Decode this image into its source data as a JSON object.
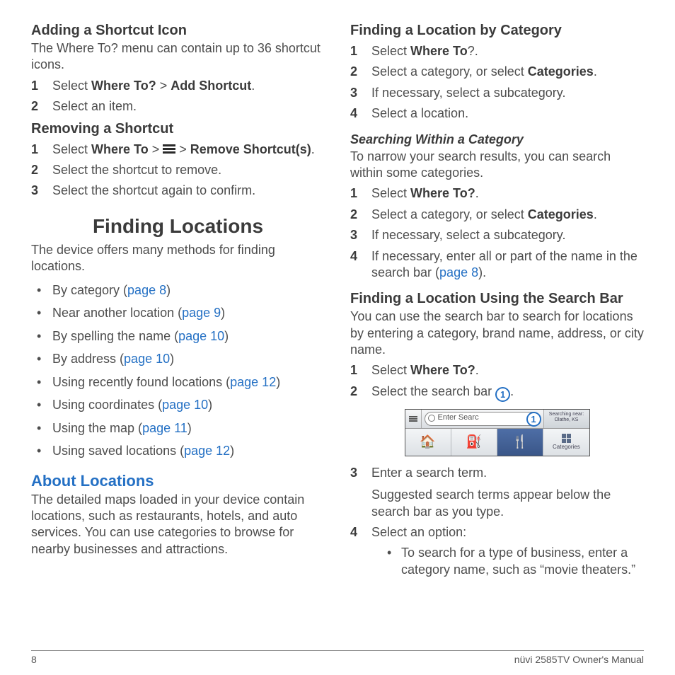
{
  "footer": {
    "pageNum": "8",
    "manual": "nüvi 2585TV Owner's Manual"
  },
  "left": {
    "adding": {
      "heading": "Adding a Shortcut Icon",
      "intro": "The Where To? menu can contain up to 36 shortcut icons.",
      "step1_pre": "Select ",
      "step1_b1": "Where To?",
      "step1_mid": " > ",
      "step1_b2": "Add Shortcut",
      "step1_post": ".",
      "step2": "Select an item."
    },
    "removing": {
      "heading": "Removing a Shortcut",
      "step1_pre": "Select ",
      "step1_b1": "Where To",
      "step1_mid1": " > ",
      "step1_mid2": " > ",
      "step1_b2": "Remove Shortcut(s)",
      "step1_post": ".",
      "step2": "Select the shortcut to remove.",
      "step3": "Select the shortcut again to confirm."
    },
    "finding": {
      "heading": "Finding Locations",
      "intro": "The device offers many methods for finding locations.",
      "b1_t": "By category (",
      "b1_l": "page 8",
      "b1_e": ")",
      "b2_t": "Near another location (",
      "b2_l": "page 9",
      "b2_e": ")",
      "b3_t": "By spelling the name (",
      "b3_l": "page 10",
      "b3_e": ")",
      "b4_t": "By address (",
      "b4_l": "page 10",
      "b4_e": ")",
      "b5_t": "Using recently found locations (",
      "b5_l": "page 12",
      "b5_e": ")",
      "b6_t": "Using coordinates (",
      "b6_l": "page 10",
      "b6_e": ")",
      "b7_t": "Using the map (",
      "b7_l": "page 11",
      "b7_e": ")",
      "b8_t": "Using saved locations (",
      "b8_l": "page 12",
      "b8_e": ")"
    },
    "about": {
      "heading": "About Locations",
      "intro": "The detailed maps loaded in your device contain locations, such as restaurants, hotels, and auto services. You can use categories to browse for nearby businesses and attractions."
    }
  },
  "right": {
    "byCat": {
      "heading": "Finding a Location by Category",
      "s1_pre": "Select ",
      "s1_b": "Where To",
      "s1_post": "?.",
      "s2_pre": "Select a category, or select ",
      "s2_b": "Categories",
      "s2_post": ".",
      "s3": "If necessary, select a subcategory.",
      "s4": "Select a location."
    },
    "within": {
      "heading": "Searching Within a Category",
      "intro": "To narrow your search results, you can search within some categories.",
      "s1_pre": "Select ",
      "s1_b": "Where To?",
      "s1_post": ".",
      "s2_pre": "Select a category, or select ",
      "s2_b": "Categories",
      "s2_post": ".",
      "s3": "If necessary, select a subcategory.",
      "s4_pre": "If necessary, enter all or part of the name in the search bar (",
      "s4_l": "page 8",
      "s4_post": ")."
    },
    "searchBar": {
      "heading": "Finding a Location Using the Search Bar",
      "intro": "You can use the search bar to search for locations by entering a category, brand name, address, or city name.",
      "s1_pre": "Select ",
      "s1_b": "Where To?",
      "s1_post": ".",
      "s2_pre": "Select the search bar ",
      "s2_c": "➀",
      "s2_post": ".",
      "figure": {
        "placeholder": "Enter Searc",
        "callout": "1",
        "near1": "Searching near:",
        "near2": "Olathe, KS",
        "catLabel": "Categories"
      },
      "s3": "Enter a search term.",
      "s3note": "Suggested search terms appear below the search bar as you type.",
      "s4": "Select an option:",
      "s4b1": "To search for a type of business, enter a category name, such as “movie theaters.”"
    }
  }
}
